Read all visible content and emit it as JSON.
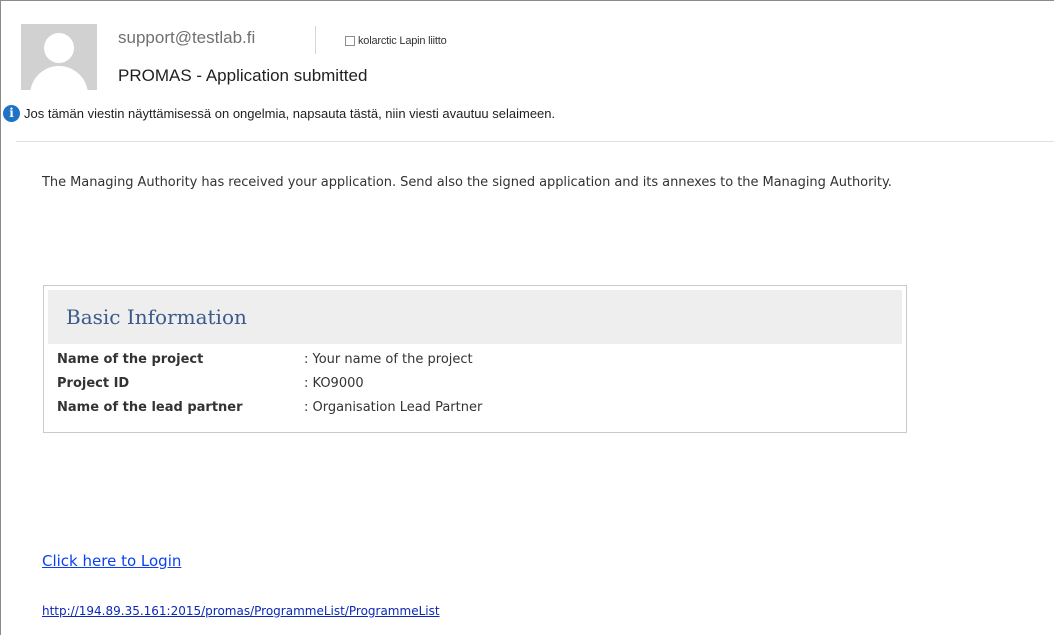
{
  "header": {
    "sender": "support@testlab.fi",
    "category": "kolarctic Lapin liitto",
    "subject": "PROMAS - Application submitted",
    "info_bar": "Jos tämän viestin näyttämisessä on ongelmia, napsauta tästä, niin viesti avautuu selaimeen.",
    "info_icon": "i"
  },
  "body": {
    "intro": "The Managing Authority has received your application. Send also the signed application and its annexes to the Managing Authority.",
    "basic_info": {
      "title": "Basic Information",
      "rows": [
        {
          "label": "Name of the project",
          "value": ": Your name of the project"
        },
        {
          "label": "Project ID",
          "value": ": KO9000"
        },
        {
          "label": "Name of the lead partner",
          "value": ": Organisation Lead Partner"
        }
      ]
    },
    "login_link": "Click here to Login",
    "url": "http://194.89.35.161:2015/promas/ProgrammeList/ProgrammeList"
  },
  "icons": {
    "avatar": "user-avatar-icon",
    "info": "info-icon",
    "category": "checkbox-icon"
  },
  "colors": {
    "info_icon": "#1f72c6",
    "card_title": "#3c5a8a",
    "link": "#0b3ff2"
  }
}
